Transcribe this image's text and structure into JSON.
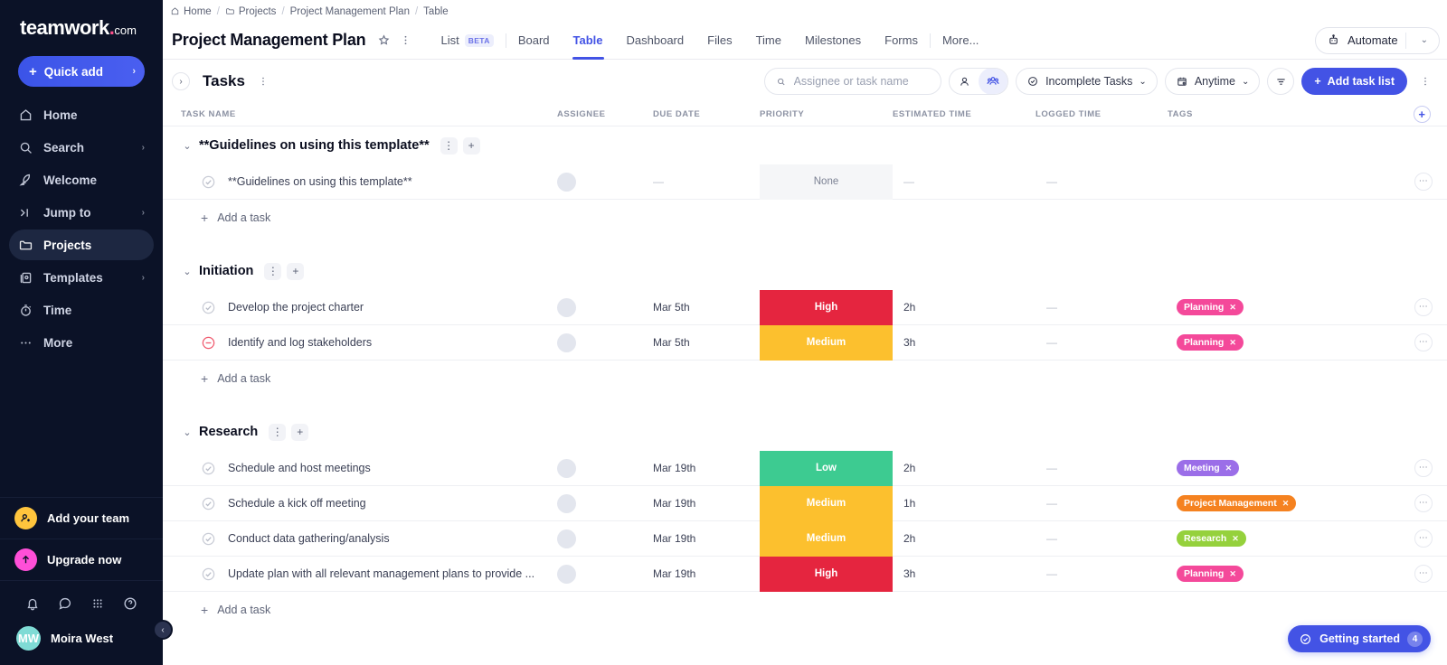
{
  "sidebar": {
    "logo": {
      "word": "teamwork",
      "dot": ".",
      "com": "com"
    },
    "quick_add": {
      "label": "Quick add"
    },
    "items": [
      {
        "label": "Home",
        "icon": "home-icon",
        "chevron": ""
      },
      {
        "label": "Search",
        "icon": "search-icon",
        "chevron": "›"
      },
      {
        "label": "Welcome",
        "icon": "rocket-icon",
        "chevron": ""
      },
      {
        "label": "Jump to",
        "icon": "jump-to-icon",
        "chevron": "›"
      },
      {
        "label": "Projects",
        "icon": "folder-icon",
        "chevron": ""
      },
      {
        "label": "Templates",
        "icon": "templates-icon",
        "chevron": "›"
      },
      {
        "label": "Time",
        "icon": "stopwatch-icon",
        "chevron": ""
      },
      {
        "label": "More",
        "icon": "ellipsis-icon",
        "chevron": ""
      }
    ],
    "active_item": "Projects",
    "promos": [
      {
        "label": "Add your team",
        "icon": "add-person-icon",
        "color": "#ffc53d"
      },
      {
        "label": "Upgrade now",
        "icon": "arrow-up-icon",
        "color": "#ff4fd8"
      }
    ],
    "tray": [
      "bell-icon",
      "chat-icon",
      "apps-grid-icon",
      "help-icon"
    ],
    "user": {
      "initials": "MW",
      "name": "Moira West"
    }
  },
  "breadcrumb": [
    {
      "label": "Home",
      "icon": "home-icon"
    },
    {
      "label": "Projects",
      "icon": "folder-icon"
    },
    {
      "label": "Project Management Plan",
      "icon": ""
    },
    {
      "label": "Table",
      "icon": ""
    }
  ],
  "header": {
    "title": "Project Management Plan",
    "tabs": [
      {
        "label": "List",
        "badge": "BETA",
        "active": false
      },
      {
        "label": "Board",
        "badge": "",
        "active": false
      },
      {
        "label": "Table",
        "badge": "",
        "active": true
      },
      {
        "label": "Dashboard",
        "badge": "",
        "active": false
      },
      {
        "label": "Files",
        "badge": "",
        "active": false
      },
      {
        "label": "Time",
        "badge": "",
        "active": false
      },
      {
        "label": "Milestones",
        "badge": "",
        "active": false
      },
      {
        "label": "Forms",
        "badge": "",
        "active": false
      },
      {
        "label": "More...",
        "badge": "",
        "active": false
      }
    ],
    "automate": {
      "label": "Automate",
      "chevron": "⌄"
    }
  },
  "toolbar": {
    "tasks_label": "Tasks",
    "search": {
      "placeholder": "Assignee or task name",
      "value": ""
    },
    "filter_tasks": {
      "label": "Incomplete Tasks",
      "chevron": "⌄"
    },
    "date_filter": {
      "label": "Anytime",
      "chevron": "⌄"
    },
    "add_task_list": {
      "label": "Add task list"
    }
  },
  "table": {
    "columns": [
      "TASK NAME",
      "ASSIGNEE",
      "DUE DATE",
      "PRIORITY",
      "ESTIMATED TIME",
      "LOGGED TIME",
      "TAGS"
    ],
    "add_a_task_label": "Add a task",
    "dash": "—",
    "groups": [
      {
        "name": "**Guidelines on using this template**",
        "rows": [
          {
            "name": "**Guidelines on using this template**",
            "status": "open",
            "assignee": "",
            "due": "—",
            "priority": {
              "label": "None",
              "color": "#f5f6f8",
              "text_color": "#7b8193"
            },
            "estimated": "—",
            "logged": "—",
            "tags": []
          }
        ]
      },
      {
        "name": "Initiation",
        "rows": [
          {
            "name": "Develop the project charter",
            "status": "open",
            "assignee": "",
            "due": "Mar 5th",
            "priority": {
              "label": "High",
              "color": "#e5253f",
              "text_color": "#ffffff"
            },
            "estimated": "2h",
            "logged": "—",
            "tags": [
              {
                "label": "Planning",
                "color": "#f4499a"
              }
            ]
          },
          {
            "name": "Identify and log stakeholders",
            "status": "blocked",
            "assignee": "",
            "due": "Mar 5th",
            "priority": {
              "label": "Medium",
              "color": "#fcc02e",
              "text_color": "#ffffff"
            },
            "estimated": "3h",
            "logged": "—",
            "tags": [
              {
                "label": "Planning",
                "color": "#f4499a"
              }
            ]
          }
        ]
      },
      {
        "name": "Research",
        "rows": [
          {
            "name": "Schedule and host meetings",
            "status": "open",
            "assignee": "",
            "due": "Mar 19th",
            "priority": {
              "label": "Low",
              "color": "#3dcb91",
              "text_color": "#ffffff"
            },
            "estimated": "2h",
            "logged": "—",
            "tags": [
              {
                "label": "Meeting",
                "color": "#9b6ee8"
              }
            ]
          },
          {
            "name": "Schedule a kick off meeting",
            "status": "open",
            "assignee": "",
            "due": "Mar 19th",
            "priority": {
              "label": "Medium",
              "color": "#fcc02e",
              "text_color": "#ffffff"
            },
            "estimated": "1h",
            "logged": "—",
            "tags": [
              {
                "label": "Project Management",
                "color": "#f58220"
              }
            ]
          },
          {
            "name": "Conduct data gathering/analysis",
            "status": "open",
            "assignee": "",
            "due": "Mar 19th",
            "priority": {
              "label": "Medium",
              "color": "#fcc02e",
              "text_color": "#ffffff"
            },
            "estimated": "2h",
            "logged": "—",
            "tags": [
              {
                "label": "Research",
                "color": "#95d13c"
              }
            ]
          },
          {
            "name": "Update plan with all relevant management plans to provide ...",
            "status": "open",
            "assignee": "",
            "due": "Mar 19th",
            "priority": {
              "label": "High",
              "color": "#e5253f",
              "text_color": "#ffffff"
            },
            "estimated": "3h",
            "logged": "—",
            "tags": [
              {
                "label": "Planning",
                "color": "#f4499a"
              }
            ]
          }
        ]
      }
    ]
  },
  "getting_started": {
    "label": "Getting started",
    "count": "4"
  },
  "colors": {
    "accent": "#4353e5",
    "sidebar_bg": "#0b1227"
  }
}
